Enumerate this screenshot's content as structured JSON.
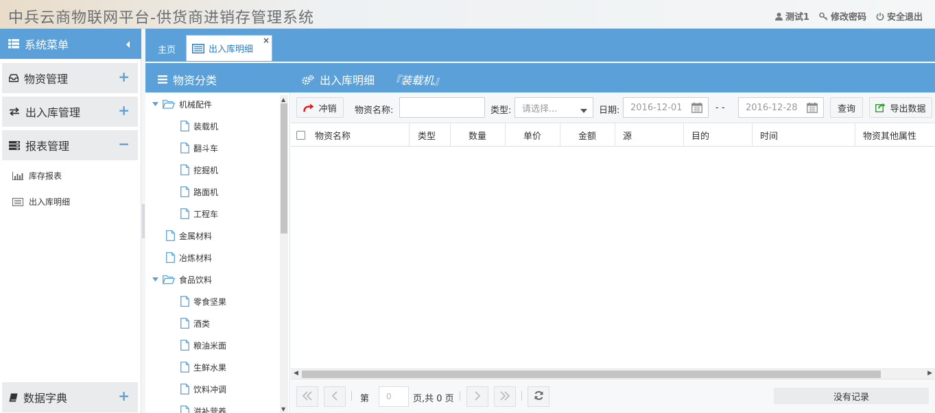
{
  "header": {
    "title": "中兵云商物联网平台-供货商进销存管理系统",
    "user": "测试1",
    "change_password": "修改密码",
    "logout": "安全退出"
  },
  "sidebar": {
    "title": "系统菜单",
    "groups": [
      {
        "label": "物资管理",
        "sign": "+"
      },
      {
        "label": "出入库管理",
        "sign": "+"
      },
      {
        "label": "报表管理",
        "sign": "−"
      }
    ],
    "report_items": [
      {
        "label": "库存报表",
        "icon": "bar-chart-icon"
      },
      {
        "label": "出入库明细",
        "icon": "list-icon"
      }
    ],
    "bottom_group": {
      "label": "数据字典",
      "sign": "+"
    }
  },
  "tabs": {
    "home": "主页",
    "active": "出入库明细",
    "close": "×"
  },
  "panel": {
    "category_title": "物资分类",
    "detail_title": "出入库明细",
    "selected_category": "『装载机』"
  },
  "tree": {
    "nodes": [
      {
        "label": "机械配件",
        "type": "folder",
        "level": 0
      },
      {
        "label": "装载机",
        "type": "file",
        "level": 1
      },
      {
        "label": "翻斗车",
        "type": "file",
        "level": 1
      },
      {
        "label": "挖掘机",
        "type": "file",
        "level": 1
      },
      {
        "label": "路面机",
        "type": "file",
        "level": 1
      },
      {
        "label": "工程车",
        "type": "file",
        "level": 1
      },
      {
        "label": "金属材料",
        "type": "file",
        "level": 0
      },
      {
        "label": "冶炼材料",
        "type": "file",
        "level": 0
      },
      {
        "label": "食品饮料",
        "type": "folder",
        "level": 0
      },
      {
        "label": "零食坚果",
        "type": "file",
        "level": 1
      },
      {
        "label": "酒类",
        "type": "file",
        "level": 1
      },
      {
        "label": "粮油米面",
        "type": "file",
        "level": 1
      },
      {
        "label": "生鲜水果",
        "type": "file",
        "level": 1
      },
      {
        "label": "饮料冲调",
        "type": "file",
        "level": 1
      },
      {
        "label": "滋补营养",
        "type": "file",
        "level": 1
      }
    ]
  },
  "toolbar": {
    "reverse_button": "冲销",
    "name_label": "物资名称:",
    "name_value": "",
    "type_label": "类型:",
    "type_placeholder": "请选择...",
    "date_label": "日期:",
    "date_from": "2016-12-01",
    "date_sep": "- -",
    "date_to": "2016-12-28",
    "query_button": "查询",
    "export_button": "导出数据"
  },
  "grid": {
    "columns": [
      "物资名称",
      "类型",
      "数量",
      "单价",
      "金额",
      "源",
      "目的",
      "时间",
      "物资其他属性"
    ]
  },
  "pager": {
    "page_prefix": "第",
    "page_value": "0",
    "page_suffix": "页,共 0 页",
    "no_record": "没有记录"
  }
}
